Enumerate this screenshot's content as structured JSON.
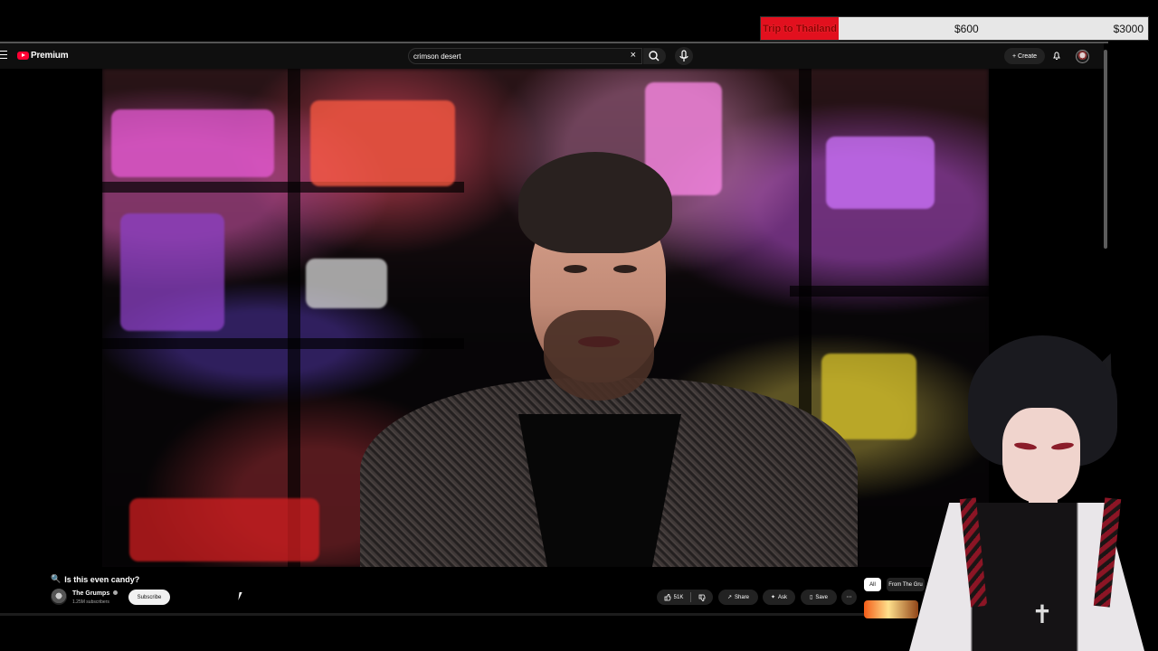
{
  "stream_goal": {
    "label": "Trip to Thailand",
    "current": "$600",
    "target": "$3000",
    "progress": 0.2,
    "fill_color": "#e2101e"
  },
  "youtube": {
    "brand": "Premium",
    "search": {
      "value": "crimson desert",
      "clear_icon": "close-icon",
      "search_icon": "search-icon",
      "mic_icon": "microphone-icon"
    },
    "create_label": "Create",
    "notification_icon": "bell-icon"
  },
  "video": {
    "title": "Is this even candy?",
    "title_icon": "magnifying-glass-icon",
    "channel_name": "The Grumps",
    "subscribers": "1.25M subscribers",
    "subscribe_label": "Subscribe",
    "likes": "51K",
    "actions": {
      "share": "Share",
      "ask": "Ask",
      "save": "Save"
    }
  },
  "right_panel": {
    "chips": [
      "All",
      "From The Gru"
    ]
  },
  "colors": {
    "youtube_red": "#ff0033",
    "background": "#000000",
    "button_dark": "#222222"
  }
}
